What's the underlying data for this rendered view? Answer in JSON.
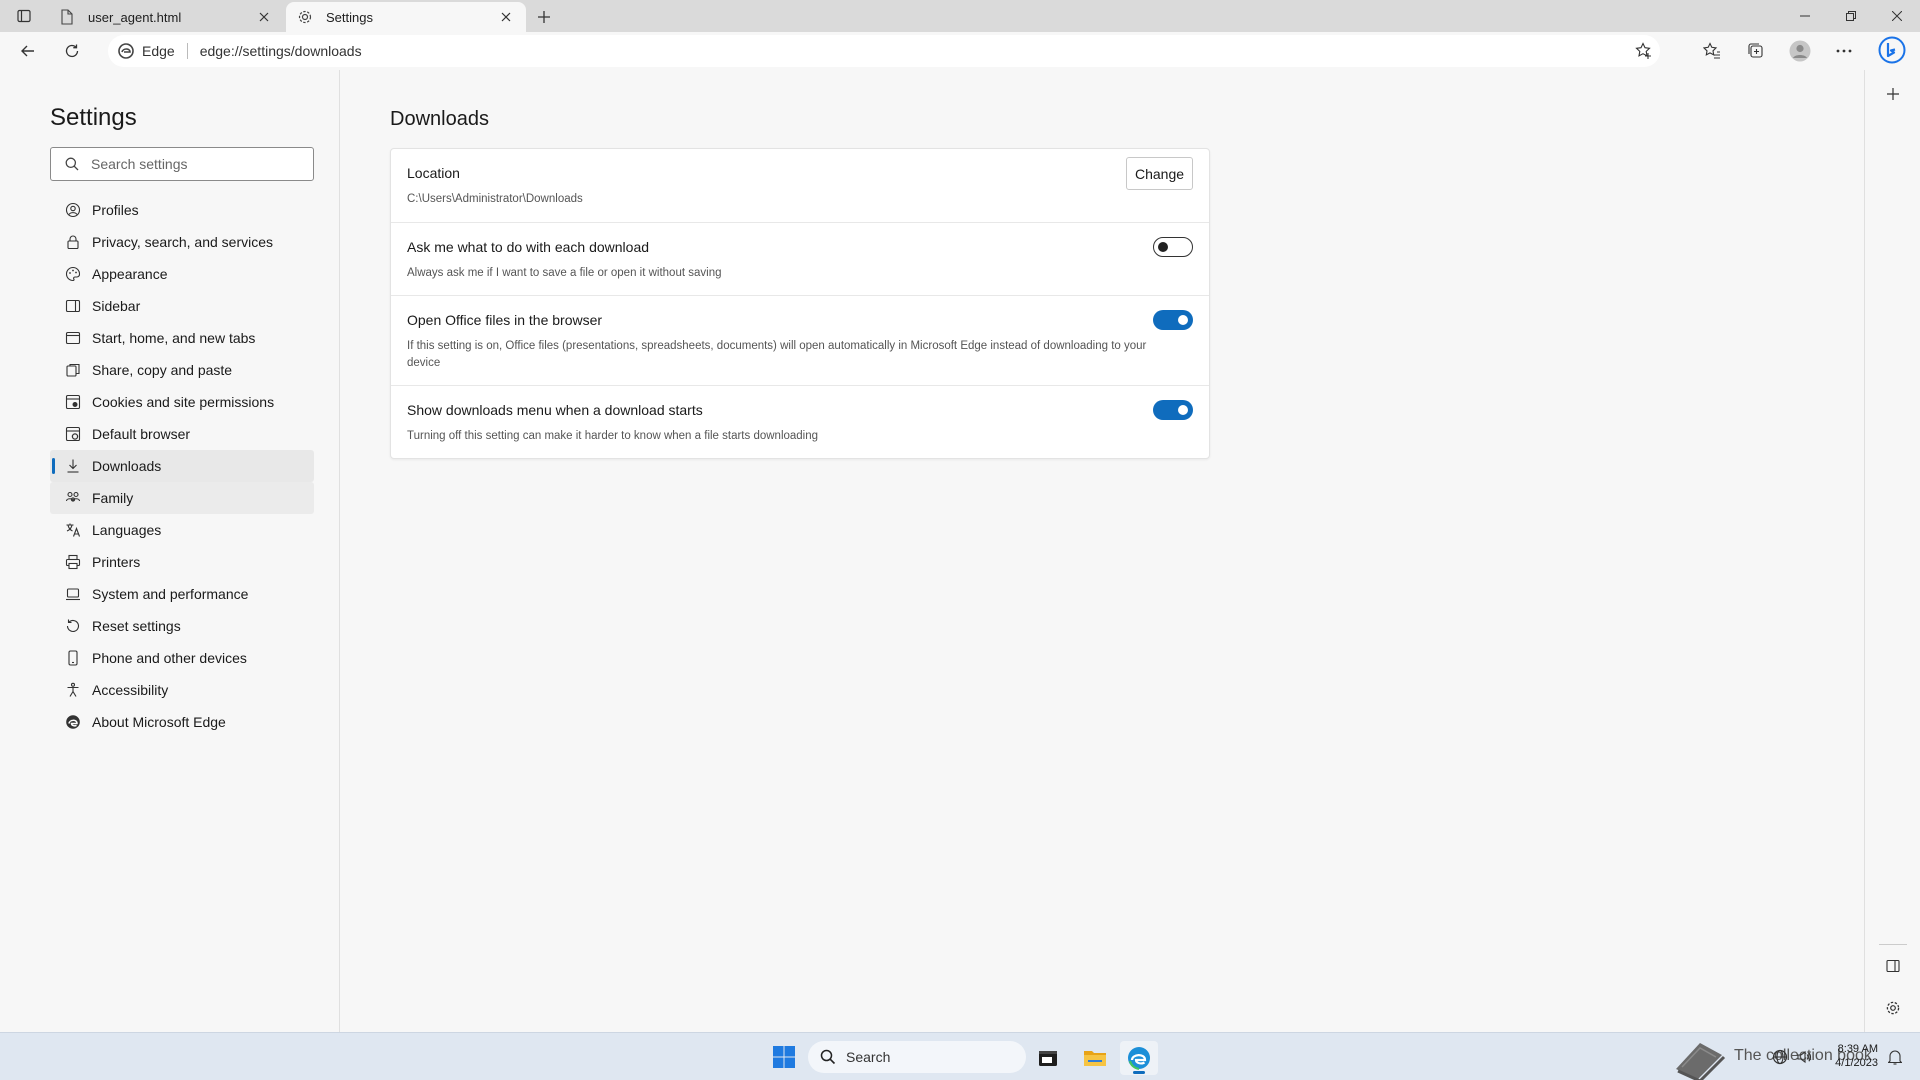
{
  "browser": {
    "tabs": [
      {
        "label": "user_agent.html",
        "active": false
      },
      {
        "label": "Settings",
        "active": true
      }
    ],
    "address": {
      "chip_label": "Edge",
      "url": "edge://settings/downloads"
    }
  },
  "settings": {
    "title": "Settings",
    "search_placeholder": "Search settings",
    "nav": [
      {
        "label": "Profiles",
        "icon": "profile-icon"
      },
      {
        "label": "Privacy, search, and services",
        "icon": "lock-icon"
      },
      {
        "label": "Appearance",
        "icon": "appearance-icon"
      },
      {
        "label": "Sidebar",
        "icon": "sidebar-icon"
      },
      {
        "label": "Start, home, and new tabs",
        "icon": "home-tabs-icon"
      },
      {
        "label": "Share, copy and paste",
        "icon": "share-icon"
      },
      {
        "label": "Cookies and site permissions",
        "icon": "cookies-icon"
      },
      {
        "label": "Default browser",
        "icon": "default-browser-icon"
      },
      {
        "label": "Downloads",
        "icon": "download-icon",
        "selected": true
      },
      {
        "label": "Family",
        "icon": "family-icon"
      },
      {
        "label": "Languages",
        "icon": "languages-icon"
      },
      {
        "label": "Printers",
        "icon": "printer-icon"
      },
      {
        "label": "System and performance",
        "icon": "system-icon"
      },
      {
        "label": "Reset settings",
        "icon": "reset-icon"
      },
      {
        "label": "Phone and other devices",
        "icon": "phone-icon"
      },
      {
        "label": "Accessibility",
        "icon": "accessibility-icon"
      },
      {
        "label": "About Microsoft Edge",
        "icon": "edge-icon"
      }
    ]
  },
  "downloads": {
    "heading": "Downloads",
    "location": {
      "title": "Location",
      "path": "C:\\Users\\Administrator\\Downloads",
      "button": "Change"
    },
    "ask": {
      "title": "Ask me what to do with each download",
      "desc": "Always ask me if I want to save a file or open it without saving",
      "enabled": false
    },
    "office": {
      "title": "Open Office files in the browser",
      "desc": "If this setting is on, Office files (presentations, spreadsheets, documents) will open automatically in Microsoft Edge instead of downloading to your device",
      "enabled": true
    },
    "menu": {
      "title": "Show downloads menu when a download starts",
      "desc": "Turning off this setting can make it harder to know when a file starts downloading",
      "enabled": true
    }
  },
  "taskbar": {
    "search_label": "Search",
    "watermark": "The collection book",
    "time": "8:39 AM",
    "date": "4/1/2023"
  },
  "colors": {
    "accent": "#0f6cbd"
  }
}
